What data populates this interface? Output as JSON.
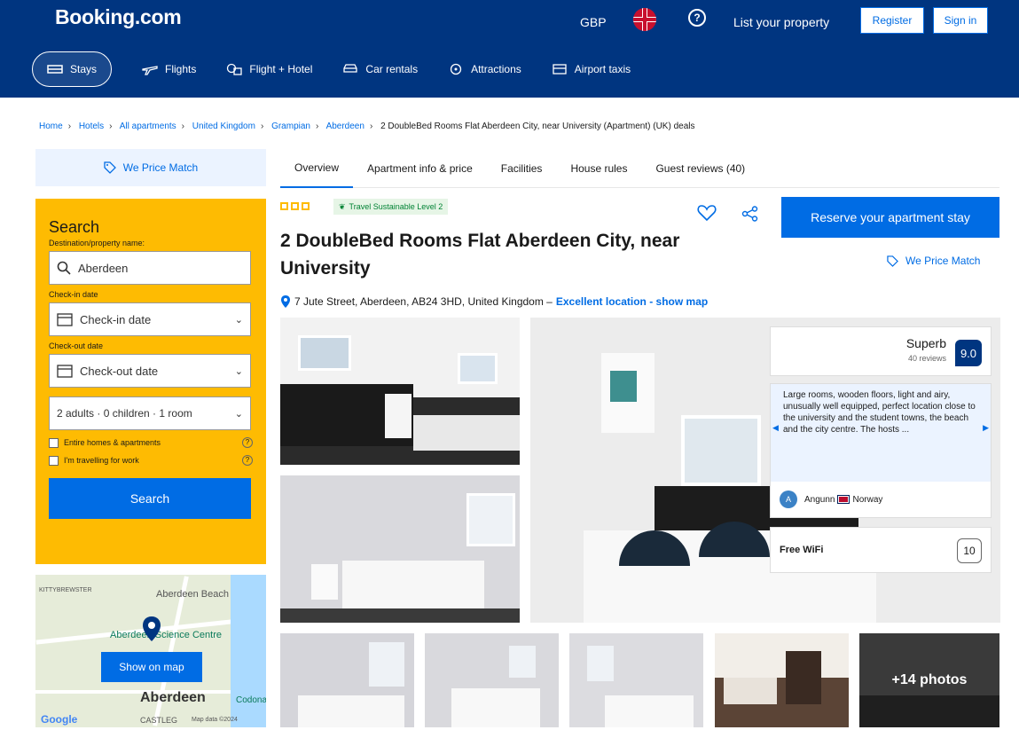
{
  "header": {
    "logo": "Booking.com",
    "currency": "GBP",
    "help": "?",
    "list_property": "List your property",
    "register": "Register",
    "sign_in": "Sign in"
  },
  "nav": {
    "items": [
      {
        "label": "Stays",
        "icon": "bed-icon"
      },
      {
        "label": "Flights",
        "icon": "plane-icon"
      },
      {
        "label": "Flight + Hotel",
        "icon": "plane-hotel-icon"
      },
      {
        "label": "Car rentals",
        "icon": "car-icon"
      },
      {
        "label": "Attractions",
        "icon": "attractions-icon"
      },
      {
        "label": "Airport taxis",
        "icon": "taxi-icon"
      }
    ]
  },
  "breadcrumbs": [
    "Home",
    "Hotels",
    "All apartments",
    "United Kingdom",
    "Grampian",
    "Aberdeen",
    "2 DoubleBed Rooms Flat Aberdeen City, near University (Apartment) (UK) deals"
  ],
  "price_match": "We Price Match",
  "tabs": [
    "Overview",
    "Apartment info & price",
    "Facilities",
    "House rules",
    "Guest reviews (40)"
  ],
  "search": {
    "title": "Search",
    "dest_label": "Destination/property name:",
    "dest_value": "Aberdeen",
    "checkin_label": "Check-in date",
    "checkin_value": "Check-in date",
    "checkout_label": "Check-out date",
    "checkout_value": "Check-out date",
    "guests": "2 adults · 0 children · 1 room",
    "opt1": "Entire homes & apartments",
    "opt2": "I'm travelling for work",
    "button": "Search"
  },
  "map": {
    "show_on_map": "Show on map",
    "label1": "Aberdeen Beach",
    "label2": "Aberdeen Science Centre",
    "label3": "Aberdeen",
    "label4": "KITTYBREWSTER",
    "label5": "Codona",
    "label6": "CASTLEG",
    "google": "Google",
    "map_data": "Map data ©2024"
  },
  "property": {
    "sustainable": "Travel Sustainable Level 2",
    "title": "2 DoubleBed Rooms Flat Aberdeen City, near University",
    "address": "7 Jute Street, Aberdeen, AB24 3HD, United Kingdom –",
    "location_link": "Excellent location - show map",
    "reserve": "Reserve your apartment stay",
    "price_match": "We Price Match"
  },
  "review": {
    "rating_word": "Superb",
    "count": "40 reviews",
    "score": "9.0",
    "quote": "Large rooms, wooden floors, light and airy, unusually well equipped, perfect location close to the university and the student towns, the beach and the city centre. The hosts ...",
    "reviewer_initial": "A",
    "reviewer": "Angunn",
    "country": "Norway",
    "wifi_label": "Free WiFi",
    "wifi_score": "10"
  },
  "photos": {
    "more": "+14 photos"
  }
}
